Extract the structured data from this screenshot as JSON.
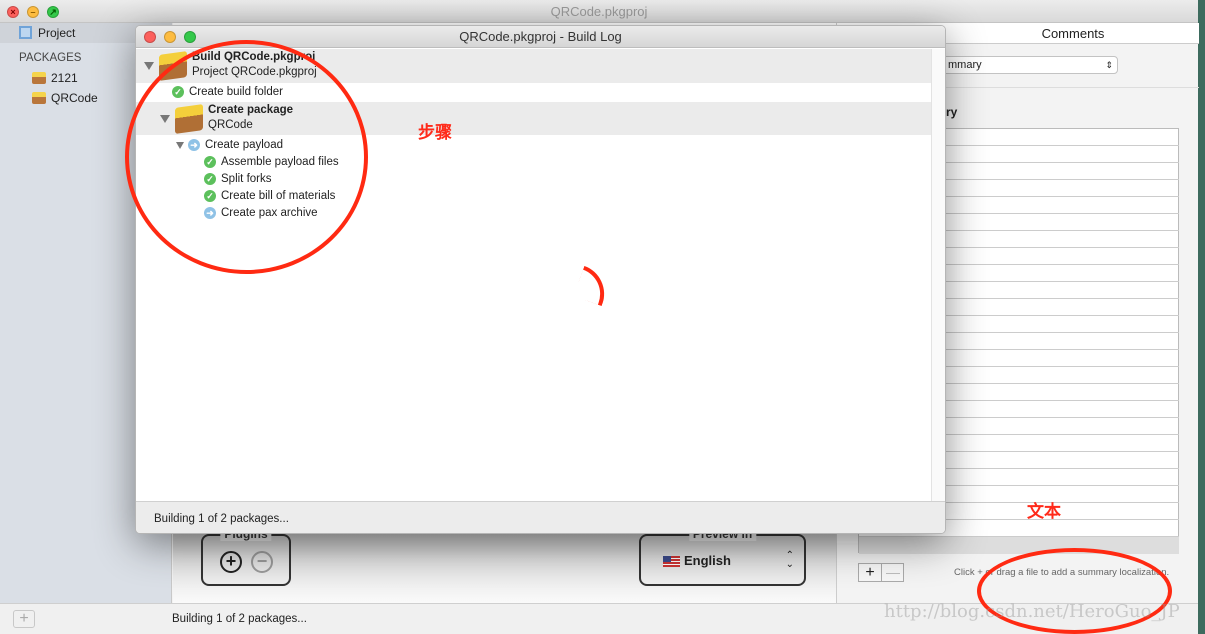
{
  "main_window": {
    "title": "QRCode.pkgproj"
  },
  "sidebar": {
    "project_label": "Project",
    "section_header": "PACKAGES",
    "packages": [
      {
        "label": "2121"
      },
      {
        "label": "QRCode"
      }
    ]
  },
  "content": {
    "plugins_label": "Plugins",
    "preview_label": "Preview in",
    "preview_language": "English"
  },
  "right_panel": {
    "tab": "Comments",
    "popup_value": "mmary",
    "section_title": "ry",
    "hint": "Click + or drag a file to add a summary localization."
  },
  "statusbar": {
    "text": "Building 1 of 2 packages..."
  },
  "build_log": {
    "title": "QRCode.pkgproj - Build Log",
    "root": {
      "title": "Build QRCode.pkgproj",
      "subtitle": "Project QRCode.pkgproj"
    },
    "create_build_folder": "Create build folder",
    "package": {
      "title": "Create package",
      "subtitle": "QRCode"
    },
    "payload": "Create payload",
    "steps": [
      {
        "label": "Assemble payload files",
        "status": "done"
      },
      {
        "label": "Split forks",
        "status": "done"
      },
      {
        "label": "Create bill of materials",
        "status": "done"
      },
      {
        "label": "Create pax archive",
        "status": "running"
      }
    ],
    "status": "Building 1 of 2 packages..."
  },
  "annotations": {
    "steps_label": "步骤",
    "text_label": "文本",
    "color": "#ff2a12"
  },
  "watermark": "http://blog.csdn.net/HeroGuo_JP"
}
